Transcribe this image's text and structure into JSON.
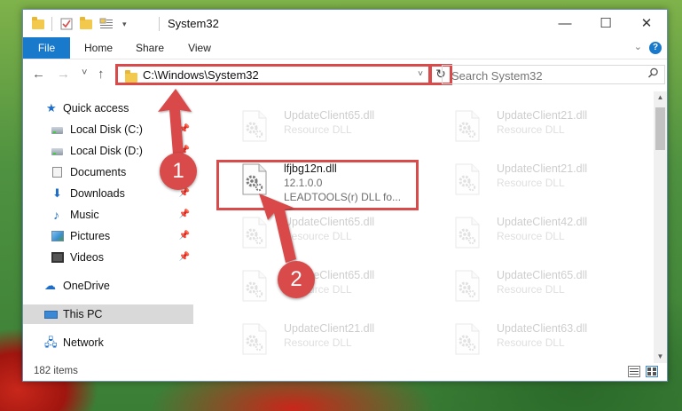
{
  "window": {
    "title": "System32"
  },
  "ribbon": {
    "tabs": [
      "File",
      "Home",
      "Share",
      "View"
    ],
    "help": "?"
  },
  "window_controls": {
    "minimize": "—",
    "maximize": "☐",
    "close": "✕"
  },
  "navigation": {
    "back": "←",
    "forward": "→",
    "recent": "˅",
    "up": "↑"
  },
  "address": {
    "path": "C:\\Windows\\System32",
    "dropdown": "˅",
    "refresh": "↻"
  },
  "search": {
    "placeholder": "Search System32",
    "icon": "search-icon"
  },
  "sidebar": {
    "items": [
      {
        "label": "Quick access",
        "icon": "star-icon",
        "pinned": false
      },
      {
        "label": "Local Disk (C:)",
        "icon": "drive-icon",
        "pinned": true
      },
      {
        "label": "Local Disk (D:)",
        "icon": "drive-icon",
        "pinned": true
      },
      {
        "label": "Documents",
        "icon": "documents-icon",
        "pinned": true
      },
      {
        "label": "Downloads",
        "icon": "downloads-icon",
        "pinned": true
      },
      {
        "label": "Music",
        "icon": "music-icon",
        "pinned": true
      },
      {
        "label": "Pictures",
        "icon": "pictures-icon",
        "pinned": true
      },
      {
        "label": "Videos",
        "icon": "videos-icon",
        "pinned": true
      },
      {
        "label": "OneDrive",
        "icon": "onedrive-icon",
        "pinned": false
      },
      {
        "label": "This PC",
        "icon": "this-pc-icon",
        "pinned": false,
        "selected": true
      },
      {
        "label": "Network",
        "icon": "network-icon",
        "pinned": false
      }
    ]
  },
  "files": {
    "left": [
      {
        "name": "UpdateClient65.dll",
        "lines": [
          "Resource DLL"
        ],
        "faded": true
      },
      {
        "name": "lfjbg12n.dll",
        "lines": [
          "12.1.0.0",
          "LEADTOOLS(r) DLL fo..."
        ],
        "faded": false
      },
      {
        "name": "UpdateClient65.dll",
        "lines": [
          "Resource DLL"
        ],
        "faded": true
      },
      {
        "name": "UpdateClient65.dll",
        "lines": [
          "Resource DLL"
        ],
        "faded": true
      },
      {
        "name": "UpdateClient21.dll",
        "lines": [
          "Resource DLL"
        ],
        "faded": true
      }
    ],
    "right": [
      {
        "name": "UpdateClient21.dll",
        "lines": [
          "Resource DLL"
        ],
        "faded": true
      },
      {
        "name": "UpdateClient21.dll",
        "lines": [
          "Resource DLL"
        ],
        "faded": true
      },
      {
        "name": "UpdateClient42.dll",
        "lines": [
          "Resource DLL"
        ],
        "faded": true
      },
      {
        "name": "UpdateClient65.dll",
        "lines": [
          "Resource DLL"
        ],
        "faded": true
      },
      {
        "name": "UpdateClient63.dll",
        "lines": [
          "Resource DLL"
        ],
        "faded": true
      }
    ]
  },
  "status": {
    "items_count": "182 items"
  },
  "annotations": [
    {
      "label": "1"
    },
    {
      "label": "2"
    }
  ],
  "colors": {
    "accent": "#1979ca",
    "annotation": "#d94a4a",
    "selected": "#d9d9d9"
  }
}
